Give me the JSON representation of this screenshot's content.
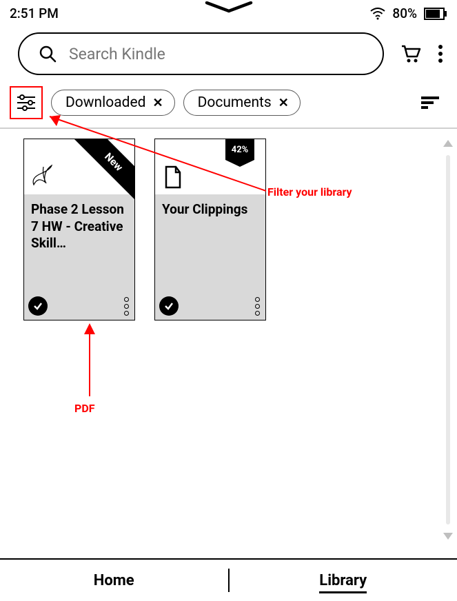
{
  "status": {
    "time": "2:51 PM",
    "battery_percent": "80%"
  },
  "search": {
    "placeholder": "Search Kindle"
  },
  "filters": {
    "chips": [
      {
        "label": "Downloaded"
      },
      {
        "label": "Documents"
      }
    ]
  },
  "books": [
    {
      "title": "Phase 2 Lesson 7 HW - Creative Skill…",
      "badge_type": "new",
      "badge_text": "New",
      "type_icon": "pdf"
    },
    {
      "title": "Your Clippings",
      "badge_type": "percent",
      "badge_text": "42%",
      "type_icon": "doc"
    }
  ],
  "annotations": {
    "filter_label": "Filter your library",
    "pdf_label": "PDF"
  },
  "nav": {
    "home": "Home",
    "library": "Library"
  }
}
